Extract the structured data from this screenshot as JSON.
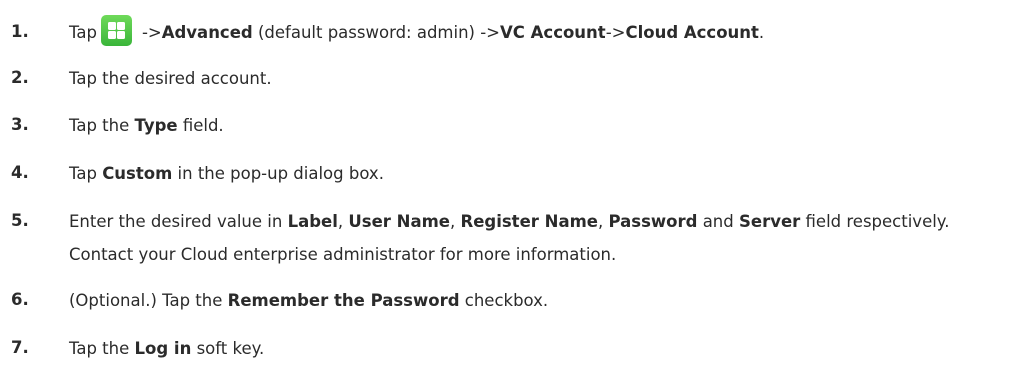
{
  "steps": [
    {
      "number": "1.",
      "parts": [
        {
          "t": "Tap",
          "b": false
        },
        {
          "icon": "menu-icon"
        },
        {
          "t": "->",
          "b": false
        },
        {
          "t": "Advanced",
          "b": true
        },
        {
          "t": " (default password: admin) ->",
          "b": false
        },
        {
          "t": "VC Account",
          "b": true
        },
        {
          "t": "->",
          "b": false
        },
        {
          "t": "Cloud Account",
          "b": true
        },
        {
          "t": ".",
          "b": false
        }
      ]
    },
    {
      "number": "2.",
      "parts": [
        {
          "t": "Tap the desired account.",
          "b": false
        }
      ]
    },
    {
      "number": "3.",
      "parts": [
        {
          "t": "Tap the ",
          "b": false
        },
        {
          "t": "Type",
          "b": true
        },
        {
          "t": " field.",
          "b": false
        }
      ]
    },
    {
      "number": "4.",
      "parts": [
        {
          "t": "Tap ",
          "b": false
        },
        {
          "t": "Custom",
          "b": true
        },
        {
          "t": " in the pop-up dialog box.",
          "b": false
        }
      ]
    },
    {
      "number": "5.",
      "parts": [
        {
          "t": "Enter the desired value in ",
          "b": false
        },
        {
          "t": "Label",
          "b": true
        },
        {
          "t": ", ",
          "b": false
        },
        {
          "t": "User Name",
          "b": true
        },
        {
          "t": ", ",
          "b": false
        },
        {
          "t": "Register Name",
          "b": true
        },
        {
          "t": ", ",
          "b": false
        },
        {
          "t": "Password",
          "b": true
        },
        {
          "t": " and ",
          "b": false
        },
        {
          "t": "Server",
          "b": true
        },
        {
          "t": " field respectively. Contact your Cloud enterprise administrator for more information.",
          "b": false
        }
      ]
    },
    {
      "number": "6.",
      "parts": [
        {
          "t": "(Optional.) Tap the ",
          "b": false
        },
        {
          "t": "Remember the Password",
          "b": true
        },
        {
          "t": " checkbox.",
          "b": false
        }
      ]
    },
    {
      "number": "7.",
      "parts": [
        {
          "t": "Tap the ",
          "b": false
        },
        {
          "t": "Log in",
          "b": true
        },
        {
          "t": " soft key.",
          "b": false
        }
      ]
    }
  ]
}
